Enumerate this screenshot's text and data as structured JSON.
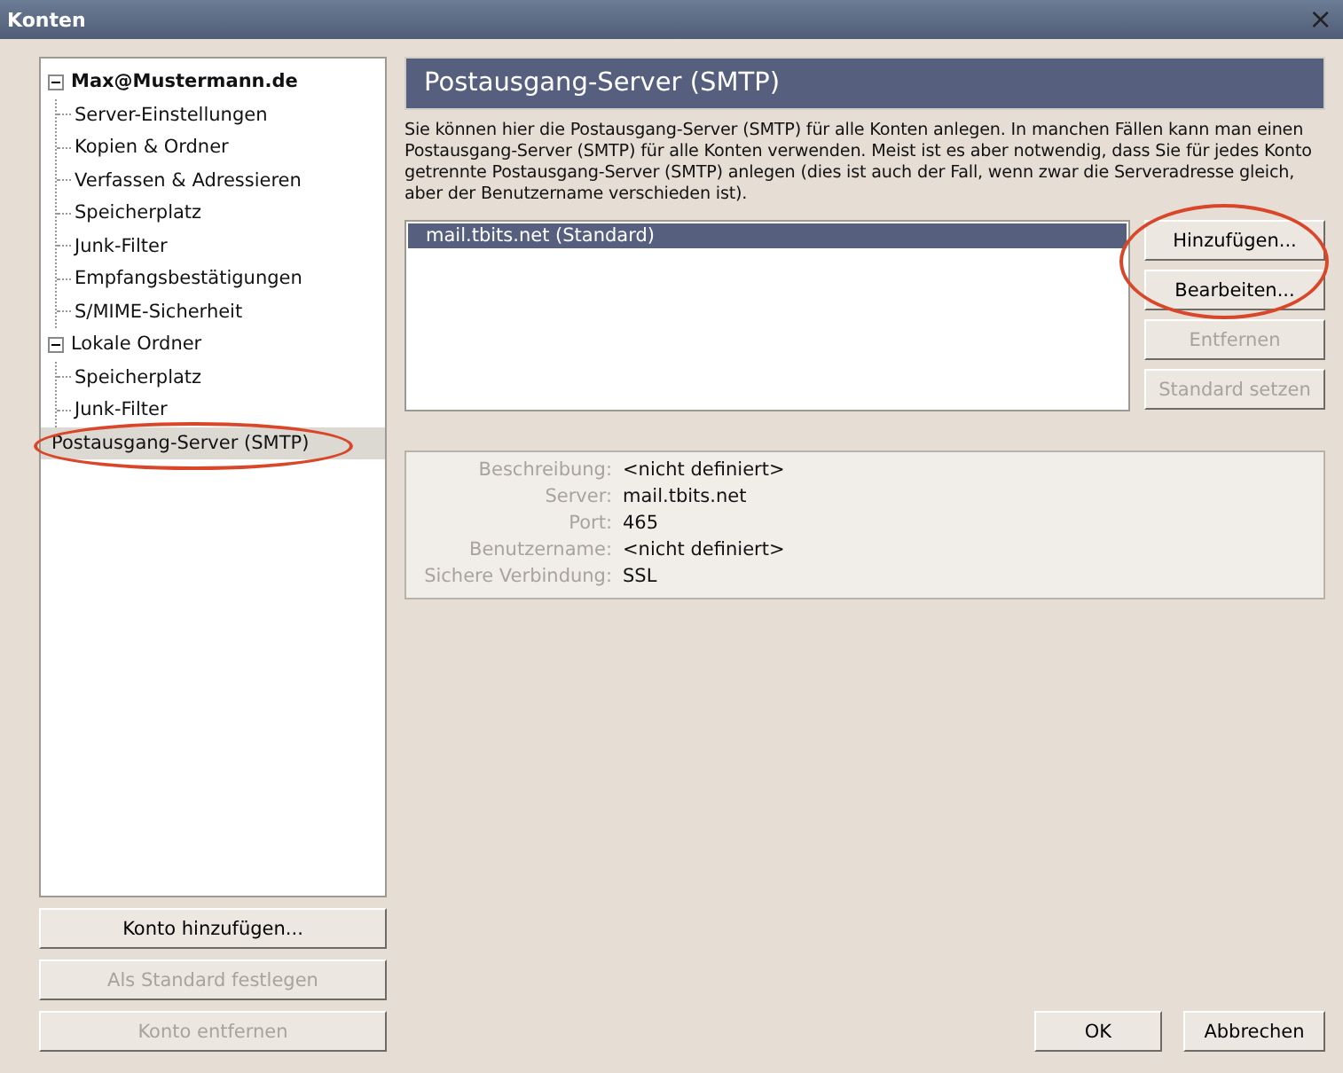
{
  "window": {
    "title": "Konten",
    "close": "×"
  },
  "tree": [
    {
      "label": "Max@Mustermann.de",
      "bold": true,
      "expanded": true,
      "selected": false,
      "circled": false,
      "children": [
        {
          "label": "Server-Einstellungen",
          "selected": false,
          "circled": false
        },
        {
          "label": "Kopien & Ordner",
          "selected": false,
          "circled": false
        },
        {
          "label": "Verfassen & Adressieren",
          "selected": false,
          "circled": false
        },
        {
          "label": "Speicherplatz",
          "selected": false,
          "circled": false
        },
        {
          "label": "Junk-Filter",
          "selected": false,
          "circled": false
        },
        {
          "label": "Empfangsbestätigungen",
          "selected": false,
          "circled": false
        },
        {
          "label": "S/MIME-Sicherheit",
          "selected": false,
          "circled": false
        }
      ]
    },
    {
      "label": "Lokale Ordner",
      "bold": false,
      "expanded": true,
      "selected": false,
      "circled": false,
      "children": [
        {
          "label": "Speicherplatz",
          "selected": false,
          "circled": false
        },
        {
          "label": "Junk-Filter",
          "selected": false,
          "circled": false
        }
      ]
    },
    {
      "label": "Postausgang-Server (SMTP)",
      "bold": false,
      "selected": true,
      "circled": true
    }
  ],
  "account_buttons": [
    {
      "label": "Konto hinzufügen...",
      "disabled": false
    },
    {
      "label": "Als Standard festlegen",
      "disabled": true
    },
    {
      "label": "Konto entfernen",
      "disabled": true
    }
  ],
  "panel": {
    "title": "Postausgang-Server (SMTP)",
    "description": "Sie können hier die Postausgang-Server (SMTP) für alle Konten anlegen. In manchen Fällen kann man einen Postausgang-Server (SMTP) für alle Konten verwenden. Meist ist es aber notwendig, dass Sie für jedes Konto getrennte Postausgang-Server (SMTP) anlegen (dies ist auch der Fall, wenn zwar die Serveradresse gleich, aber der Benutzername verschieden ist).",
    "servers": [
      {
        "label": "mail.tbits.net (Standard)",
        "selected": true
      }
    ],
    "server_buttons": [
      {
        "label": "Hinzufügen...",
        "disabled": false,
        "circled": true
      },
      {
        "label": "Bearbeiten...",
        "disabled": false,
        "circled": true
      },
      {
        "label": "Entfernen",
        "disabled": true,
        "circled": false
      },
      {
        "label": "Standard setzen",
        "disabled": true,
        "circled": false
      }
    ],
    "details": [
      {
        "label": "Beschreibung:",
        "value": "<nicht definiert>"
      },
      {
        "label": "Server:",
        "value": "mail.tbits.net"
      },
      {
        "label": "Port:",
        "value": "465"
      },
      {
        "label": "Benutzername:",
        "value": "<nicht definiert>"
      },
      {
        "label": "Sichere Verbindung:",
        "value": "SSL"
      }
    ]
  },
  "dialog_buttons": [
    "OK",
    "Abbrechen"
  ]
}
